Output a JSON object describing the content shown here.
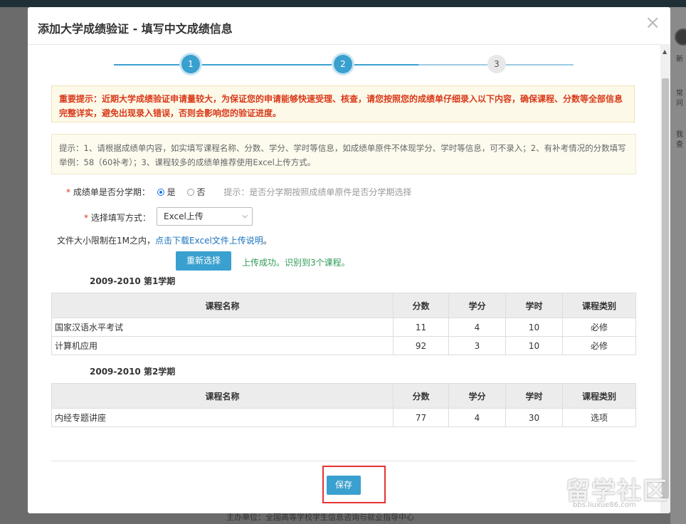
{
  "modal": {
    "title": "添加大学成绩验证 - 填写中文成绩信息",
    "close_glyph": "×"
  },
  "steps": [
    {
      "label": "1",
      "state": "done"
    },
    {
      "label": "2",
      "state": "active"
    },
    {
      "label": "3",
      "state": "todo"
    }
  ],
  "notice": {
    "important": "重要提示：近期大学成绩验证申请量较大，为保证您的申请能够快速受理、核查，请您按照您的成绩单仔细录入以下内容，确保课程、分数等全部信息完整详实，避免出现录入错误，否则会影响您的验证进度。",
    "tip": "提示：1、请根据成绩单内容，如实填写课程名称、分数、学分、学时等信息，如成绩单原件不体现学分、学时等信息，可不录入；2、有补考情况的分数填写举例：58（60补考）；3、课程较多的成绩单推荐使用Excel上传方式。"
  },
  "form": {
    "semester_label": "成绩单是否分学期：",
    "opt_yes": "是",
    "opt_no": "否",
    "semester_hint": "提示：是否分学期按照成绩单原件是否分学期选择",
    "mode_label": "选择填写方式：",
    "mode_value": "Excel上传",
    "file_limit": "文件大小限制在1M之内，",
    "file_link": "点击下载Excel文件上传说明",
    "file_period": "。",
    "reselect": "重新选择",
    "upload_status": "上传成功。识别到3个课程。"
  },
  "columns": [
    "课程名称",
    "分数",
    "学分",
    "学时",
    "课程类别"
  ],
  "terms": [
    {
      "title": "2009-2010 第1学期",
      "rows": [
        [
          "国家汉语水平考试",
          "11",
          "4",
          "10",
          "必修"
        ],
        [
          "计算机应用",
          "92",
          "3",
          "10",
          "必修"
        ]
      ]
    },
    {
      "title": "2009-2010 第2学期",
      "rows": [
        [
          "内经专题讲座",
          "77",
          "4",
          "30",
          "选项"
        ]
      ]
    }
  ],
  "footer": {
    "save": "保存"
  },
  "background": {
    "bottom_text": "主办单位：全国高等学校学生信息咨询与就业指导中心",
    "side_texts": [
      "新",
      "常",
      "问",
      "我",
      "查"
    ]
  },
  "watermark": {
    "main": "留学社区",
    "url": "bbs.liuxue86.com"
  },
  "colors": {
    "accent": "#3aa0cf",
    "warning_text": "#d9391a",
    "success_text": "#2e9a56",
    "link": "#1a73c0",
    "highlight_box": "#e63333"
  }
}
